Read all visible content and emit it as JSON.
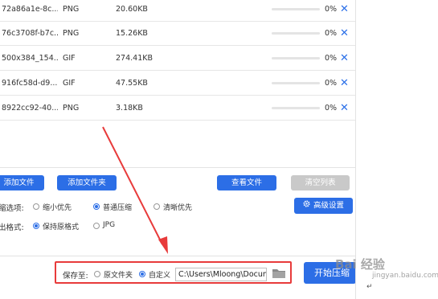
{
  "files": [
    {
      "name": "72a86a1e-8c...",
      "format": "PNG",
      "size": "20.60KB",
      "progress": 0,
      "percent": "0%",
      "delete": "✕"
    },
    {
      "name": "76c3708f-b7c...",
      "format": "PNG",
      "size": "15.26KB",
      "progress": 0,
      "percent": "0%",
      "delete": "✕"
    },
    {
      "name": "500x384_154...",
      "format": "GIF",
      "size": "274.41KB",
      "progress": 0,
      "percent": "0%",
      "delete": "✕"
    },
    {
      "name": "916fc58d-d9...",
      "format": "GIF",
      "size": "47.55KB",
      "progress": 0,
      "percent": "0%",
      "delete": "✕"
    },
    {
      "name": "8922cc92-40...",
      "format": "PNG",
      "size": "3.18KB",
      "progress": 0,
      "percent": "0%",
      "delete": "✕"
    }
  ],
  "toolbar": {
    "add_file": "添加文件",
    "add_folder": "添加文件夹",
    "view_files": "查看文件",
    "clear_list": "清空列表"
  },
  "compress_options": {
    "label": "缩选项:",
    "options": [
      "缩小优先",
      "普通压缩",
      "清晰优先"
    ],
    "selected": "普通压缩"
  },
  "output_format": {
    "label": "出格式:",
    "options": [
      "保持原格式",
      "JPG"
    ],
    "selected": "保持原格式"
  },
  "advanced_settings": "高级设置",
  "save_to": {
    "label": "保存至:",
    "options": [
      "原文件夹",
      "自定义"
    ],
    "selected": "自定义",
    "path": "C:\\Users\\Mloong\\Documents"
  },
  "start_button": "开始压缩",
  "icons": {
    "delete": "close-icon",
    "settings": "gear-icon",
    "browse": "folder-icon"
  },
  "colors": {
    "accent": "#2c6ee6",
    "highlight": "#e83b3b",
    "disabled": "#c9c9c9"
  },
  "watermark": {
    "logo": "Bai 经验",
    "sub": "jingyan.baidu.com"
  }
}
